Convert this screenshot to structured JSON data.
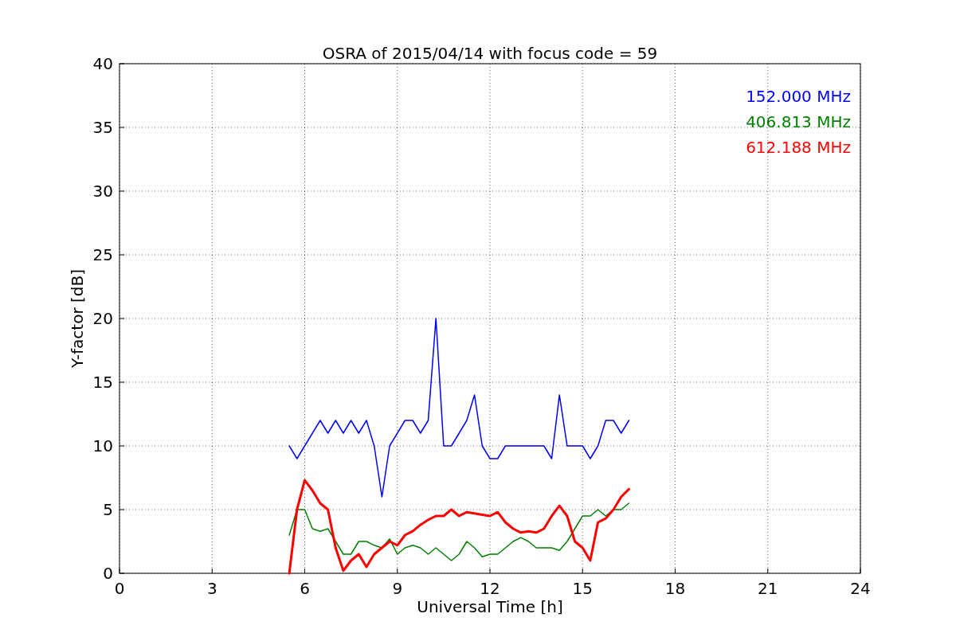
{
  "figure": {
    "chart_data": {
      "type": "line",
      "title": "OSRA of 2015/04/14 with focus code = 59",
      "xlabel": "Universal Time [h]",
      "ylabel": "Y-factor [dB]",
      "x": [
        5.5,
        5.75,
        6,
        6.25,
        6.5,
        6.75,
        7,
        7.25,
        7.5,
        7.75,
        8,
        8.25,
        8.5,
        8.75,
        9,
        9.25,
        9.5,
        9.75,
        10,
        10.25,
        10.5,
        10.75,
        11,
        11.25,
        11.5,
        11.75,
        12,
        12.25,
        12.5,
        12.75,
        13,
        13.25,
        13.5,
        13.75,
        14,
        14.25,
        14.5,
        14.75,
        15,
        15.25,
        15.5,
        15.75,
        16,
        16.25,
        16.5
      ],
      "series": [
        {
          "name": "152.000 MHz",
          "color": "#0000ff",
          "values": [
            10,
            9,
            10,
            11,
            12,
            11,
            12,
            11,
            12,
            11,
            12,
            10,
            6,
            10,
            11,
            12,
            12,
            11,
            12,
            20,
            10,
            10,
            11,
            12,
            14,
            10,
            9,
            9,
            10,
            10,
            10,
            10,
            10,
            10,
            9,
            14,
            10,
            10,
            10,
            9,
            10,
            12,
            12,
            11,
            12
          ]
        },
        {
          "name": "406.813 MHz",
          "color": "#008000",
          "values": [
            3,
            5,
            5,
            3.5,
            3.3,
            3.5,
            2.5,
            1.5,
            1.5,
            2.5,
            2.5,
            2.2,
            2,
            2.7,
            1.5,
            2,
            2.2,
            2,
            1.5,
            2,
            1.5,
            1,
            1.5,
            2.5,
            2,
            1.3,
            1.5,
            1.5,
            2,
            2.5,
            2.8,
            2.5,
            2,
            2,
            2,
            1.8,
            2.5,
            3.5,
            4.5,
            4.5,
            5,
            4.5,
            5,
            5,
            5.5
          ]
        },
        {
          "name": "612.188 MHz",
          "color": "#ff0000",
          "values": [
            0,
            5,
            7.3,
            6.5,
            5.5,
            5,
            2,
            0.2,
            1,
            1.5,
            0.5,
            1.5,
            2,
            2.5,
            2.2,
            3,
            3.3,
            3.8,
            4.2,
            4.5,
            4.5,
            5,
            4.5,
            4.8,
            4.7,
            4.6,
            4.5,
            4.8,
            4,
            3.5,
            3.2,
            3.3,
            3.2,
            3.5,
            4.5,
            5.3,
            4.5,
            2.5,
            2,
            1,
            4,
            4.3,
            5,
            6,
            6.6
          ]
        }
      ],
      "grid": true,
      "xlim": [
        0,
        24
      ],
      "ylim": [
        0,
        40
      ],
      "xticks": [
        0,
        3,
        6,
        9,
        12,
        15,
        18,
        21,
        24
      ],
      "yticks": [
        0,
        5,
        10,
        15,
        20,
        25,
        30,
        35,
        40
      ]
    }
  }
}
